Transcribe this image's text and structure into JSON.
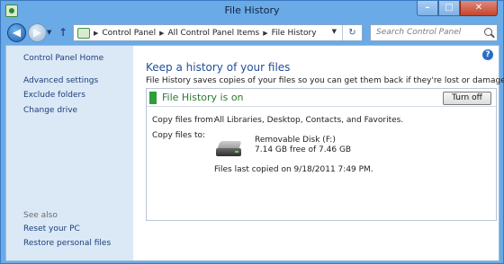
{
  "window": {
    "title": "File History",
    "controls": {
      "minimize": "–",
      "maximize": "□",
      "close": "✕"
    }
  },
  "nav": {
    "back_glyph": "◀",
    "forward_glyph": "▶",
    "dropdown_glyph": "▼",
    "up_glyph": "↑"
  },
  "address": {
    "crumbs": [
      "Control Panel",
      "All Control Panel Items",
      "File History"
    ],
    "separator": "▶",
    "dropdown_glyph": "▼",
    "refresh_glyph": "↻"
  },
  "search": {
    "placeholder": "Search Control Panel"
  },
  "sidebar": {
    "home": "Control Panel Home",
    "links": [
      "Advanced settings",
      "Exclude folders",
      "Change drive"
    ],
    "see_also_label": "See also",
    "see_also_links": [
      "Reset your PC",
      "Restore personal files"
    ]
  },
  "help": {
    "glyph": "?"
  },
  "main": {
    "title": "Keep a history of your files",
    "description": "File History saves copies of your files so you can get them back if they're lost or damaged."
  },
  "panel": {
    "status": "File History is on",
    "status_color": "#2f9e3b",
    "button": "Turn off",
    "copy_from_label": "Copy files from:",
    "copy_from_value": "All Libraries, Desktop, Contacts, and Favorites.",
    "copy_to_label": "Copy files to:",
    "drive_name": "Removable Disk (F:)",
    "drive_space": "7.14 GB free of 7.46 GB",
    "last_copied": "Files last copied on 9/18/2011 7:49 PM."
  }
}
